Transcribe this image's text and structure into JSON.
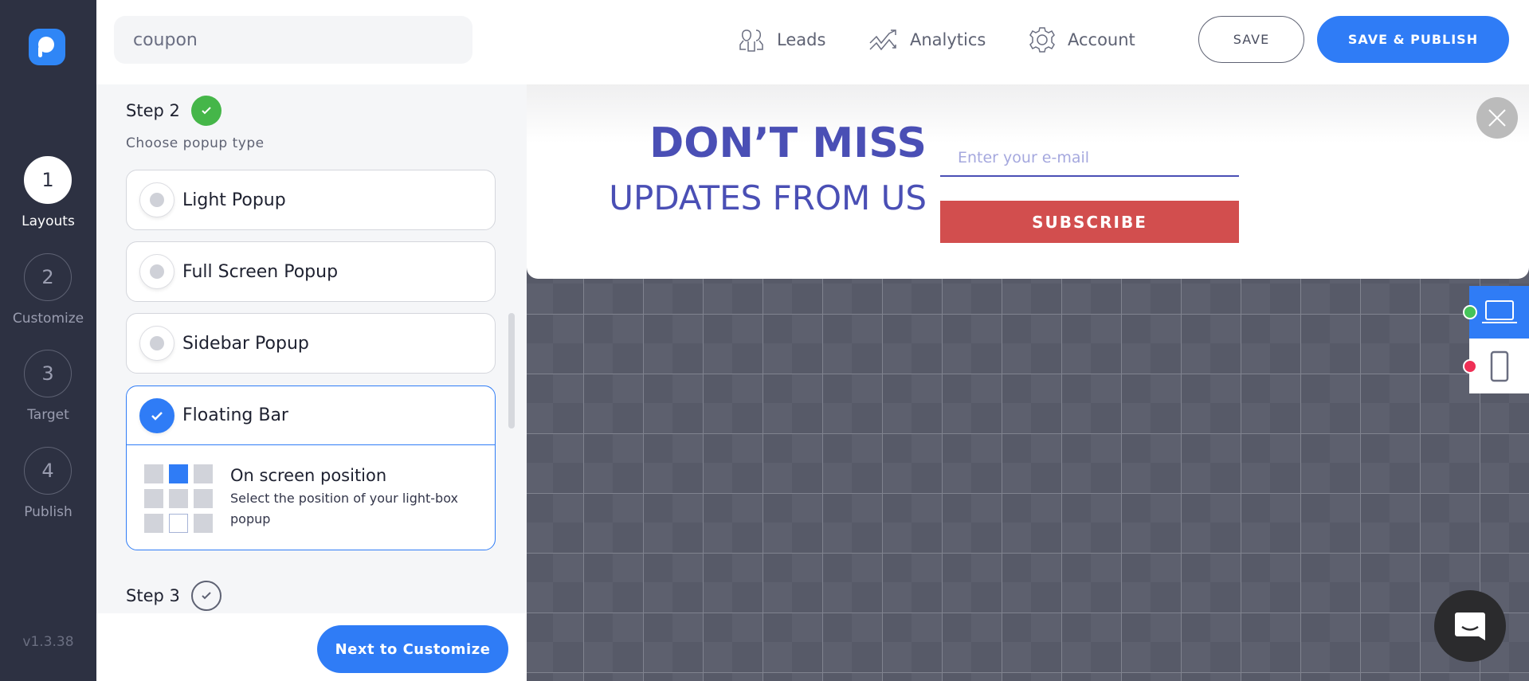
{
  "sidebar": {
    "steps": [
      {
        "num": "1",
        "label": "Layouts",
        "active": true
      },
      {
        "num": "2",
        "label": "Customize"
      },
      {
        "num": "3",
        "label": "Target"
      },
      {
        "num": "4",
        "label": "Publish"
      }
    ],
    "version": "v1.3.38"
  },
  "header": {
    "search_value": "coupon",
    "nav": [
      {
        "label": "Leads",
        "icon": "users-icon"
      },
      {
        "label": "Analytics",
        "icon": "analytics-icon"
      },
      {
        "label": "Account",
        "icon": "gear-icon"
      }
    ],
    "save_label": "SAVE",
    "publish_label": "SAVE & PUBLISH"
  },
  "panel": {
    "step2": "Step 2",
    "subtitle": "Choose popup type",
    "options": [
      "Light Popup",
      "Full Screen Popup",
      "Sidebar Popup",
      "Floating Bar"
    ],
    "selected": "Floating Bar",
    "position_title": "On screen position",
    "position_desc": "Select the position of your light-box popup",
    "step3": "Step 3",
    "next_label": "Next to Customize"
  },
  "preview": {
    "headline": "DON’T MISS",
    "subheadline": "UPDATES FROM US",
    "email_placeholder": "Enter your e-mail",
    "subscribe_label": "SUBSCRIBE"
  },
  "colors": {
    "accent": "#2f7cf6",
    "sidebar": "#2d3142",
    "headline": "#4a4fb5",
    "subscribe": "#d24e4e",
    "success": "#45b649"
  }
}
